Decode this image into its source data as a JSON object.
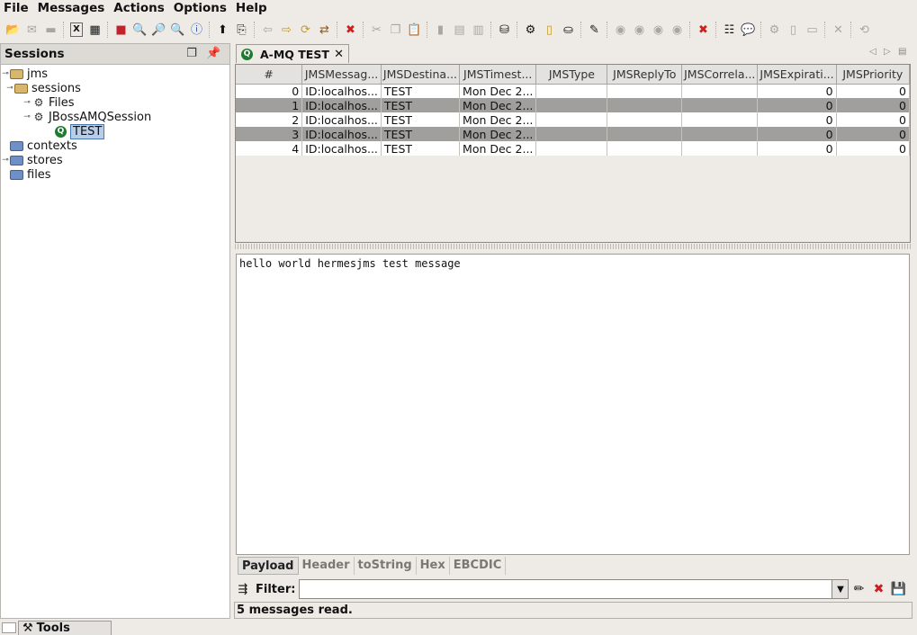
{
  "menubar": {
    "items": [
      "File",
      "Messages",
      "Actions",
      "Options",
      "Help"
    ]
  },
  "toolbar": {
    "icons": [
      {
        "name": "open-folder-icon",
        "glyph": "📂"
      },
      {
        "name": "open-message-icon",
        "glyph": "✉"
      },
      {
        "name": "save-icon",
        "glyph": "▬"
      },
      {
        "name": "xml-icon",
        "glyph": "X"
      },
      {
        "name": "xml-table-icon",
        "glyph": "▦"
      },
      {
        "name": "stop-icon",
        "glyph": "■"
      },
      {
        "name": "search-icon",
        "glyph": "🔍"
      },
      {
        "name": "sql-search-icon",
        "glyph": "🔎"
      },
      {
        "name": "search-plus-icon",
        "glyph": "🔍"
      },
      {
        "name": "info-icon",
        "glyph": "ⓘ"
      },
      {
        "name": "upload-icon",
        "glyph": "⬆"
      },
      {
        "name": "export-icon",
        "glyph": "⎘"
      },
      {
        "name": "back-icon",
        "glyph": "⇦"
      },
      {
        "name": "forward-icon",
        "glyph": "⇨"
      },
      {
        "name": "refresh-icon",
        "glyph": "⟳"
      },
      {
        "name": "transfer-icon",
        "glyph": "⇄"
      },
      {
        "name": "delete-icon",
        "glyph": "✖"
      },
      {
        "name": "cut-icon",
        "glyph": "✂"
      },
      {
        "name": "copy-icon",
        "glyph": "❐"
      },
      {
        "name": "paste-icon",
        "glyph": "📋"
      },
      {
        "name": "delete-doc-icon",
        "glyph": "▮"
      },
      {
        "name": "chart-icon",
        "glyph": "▤"
      },
      {
        "name": "chart-x-icon",
        "glyph": "▥"
      },
      {
        "name": "deploy-icon",
        "glyph": "⛁"
      },
      {
        "name": "session-tree-icon",
        "glyph": "⚙"
      },
      {
        "name": "jar-icon",
        "glyph": "▯"
      },
      {
        "name": "database-icon",
        "glyph": "⛀"
      },
      {
        "name": "edit-icon",
        "glyph": "✎"
      },
      {
        "name": "circle-1-icon",
        "glyph": "◉"
      },
      {
        "name": "circle-2-icon",
        "glyph": "◉"
      },
      {
        "name": "circle-3-icon",
        "glyph": "◉"
      },
      {
        "name": "circle-4-icon",
        "glyph": "◉"
      },
      {
        "name": "remove-icon",
        "glyph": "✖"
      },
      {
        "name": "properties-icon",
        "glyph": "☷"
      },
      {
        "name": "chat-icon",
        "glyph": "💬"
      },
      {
        "name": "link-icon",
        "glyph": "⚙"
      },
      {
        "name": "file-icon",
        "glyph": "▯"
      },
      {
        "name": "window-icon",
        "glyph": "▭"
      },
      {
        "name": "close-icon",
        "glyph": "✕"
      },
      {
        "name": "sync-icon",
        "glyph": "⟲"
      }
    ]
  },
  "sessions": {
    "title": "Sessions",
    "tree": {
      "root": "jms",
      "sessions_folder": "sessions",
      "files": "Files",
      "jboss_session": "JBossAMQSession",
      "queue": "TEST",
      "contexts": "contexts",
      "stores": "stores",
      "files_folder": "files"
    }
  },
  "editor": {
    "tab_title": "A-MQ TEST",
    "columns": [
      "#",
      "JMSMessag...",
      "JMSDestina...",
      "JMSTimest...",
      "JMSType",
      "JMSReplyTo",
      "JMSCorrela...",
      "JMSExpirati...",
      "JMSPriority"
    ],
    "rows": [
      {
        "index": "0",
        "message_id": "ID:localhos...",
        "destination": "TEST",
        "timestamp": "Mon Dec 2...",
        "type": "",
        "reply_to": "",
        "correlation": "",
        "expiration": "0",
        "priority": "0"
      },
      {
        "index": "1",
        "message_id": "ID:localhos...",
        "destination": "TEST",
        "timestamp": "Mon Dec 2...",
        "type": "",
        "reply_to": "",
        "correlation": "",
        "expiration": "0",
        "priority": "0"
      },
      {
        "index": "2",
        "message_id": "ID:localhos...",
        "destination": "TEST",
        "timestamp": "Mon Dec 2...",
        "type": "",
        "reply_to": "",
        "correlation": "",
        "expiration": "0",
        "priority": "0"
      },
      {
        "index": "3",
        "message_id": "ID:localhos...",
        "destination": "TEST",
        "timestamp": "Mon Dec 2...",
        "type": "",
        "reply_to": "",
        "correlation": "",
        "expiration": "0",
        "priority": "0"
      },
      {
        "index": "4",
        "message_id": "ID:localhos...",
        "destination": "TEST",
        "timestamp": "Mon Dec 2...",
        "type": "",
        "reply_to": "",
        "correlation": "",
        "expiration": "0",
        "priority": "0"
      }
    ],
    "payload_text": "hello world hermesjms test message",
    "bottom_tabs": [
      "Payload",
      "Header",
      "toString",
      "Hex",
      "EBCDIC"
    ],
    "active_bottom_tab": "Payload",
    "filter_label": "Filter:",
    "filter_value": "",
    "status": "5 messages read."
  },
  "dock": {
    "tools_label": "Tools"
  },
  "colors": {
    "row_alt": "#a19f9b",
    "delete_red": "#cc1f1f",
    "queue_green": "#1e7a2e"
  }
}
